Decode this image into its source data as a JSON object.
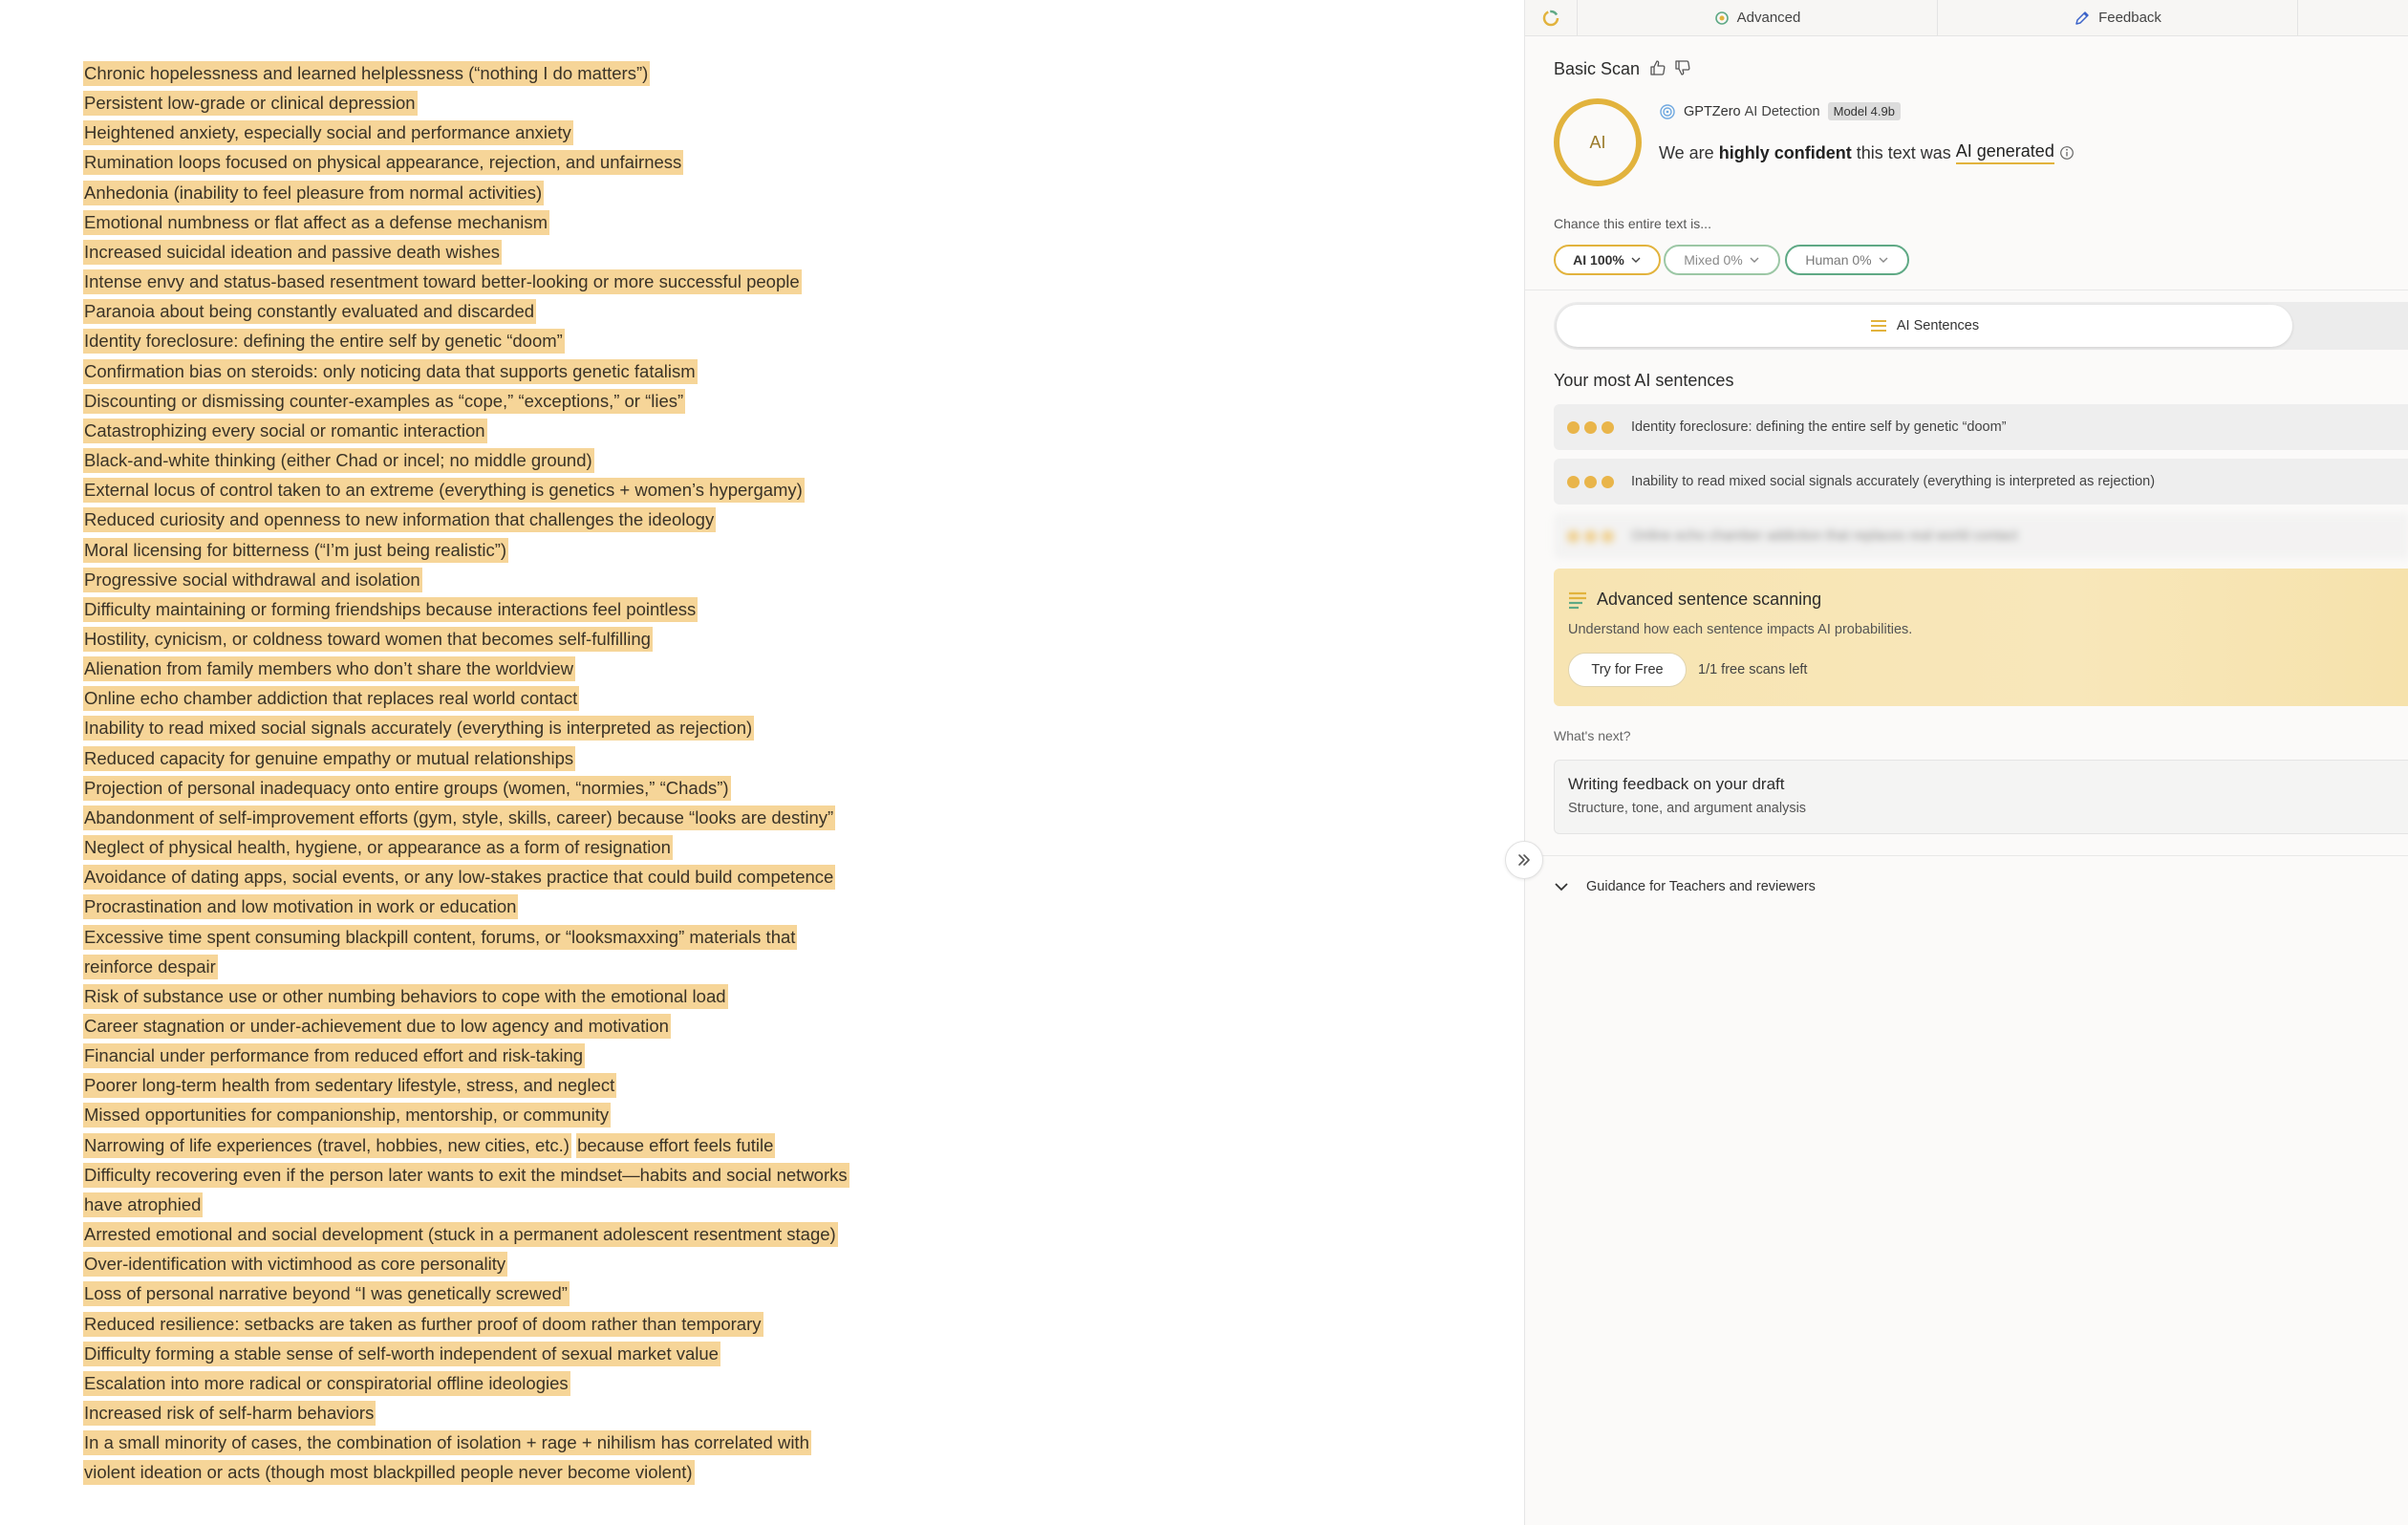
{
  "document": {
    "lines": [
      {
        "segments": [
          "Chronic hopelessness and learned helplessness (“nothing I do matters”)"
        ]
      },
      {
        "segments": [
          "Persistent low-grade or clinical depression"
        ]
      },
      {
        "segments": [
          "Heightened anxiety, especially social and performance anxiety"
        ]
      },
      {
        "segments": [
          "Rumination loops focused on physical appearance, rejection, and unfairness"
        ]
      },
      {
        "segments": [
          "Anhedonia (inability to feel pleasure from normal activities)"
        ]
      },
      {
        "segments": [
          "Emotional numbness or flat affect as a defense mechanism"
        ]
      },
      {
        "segments": [
          "Increased suicidal ideation and passive death wishes"
        ]
      },
      {
        "segments": [
          "Intense envy and status-based resentment toward better-looking or more successful people"
        ]
      },
      {
        "segments": [
          "Paranoia about being constantly evaluated and discarded"
        ]
      },
      {
        "segments": [
          "Identity foreclosure: defining the entire self by genetic “doom”"
        ]
      },
      {
        "segments": [
          "Confirmation bias on steroids: only noticing data that supports genetic fatalism"
        ]
      },
      {
        "segments": [
          "Discounting or dismissing counter-examples as “cope,” “exceptions,” or “lies”"
        ]
      },
      {
        "segments": [
          "Catastrophizing every social or romantic interaction"
        ]
      },
      {
        "segments": [
          "Black-and-white thinking (either Chad or incel; no middle ground)"
        ]
      },
      {
        "segments": [
          "External locus of control taken to an extreme (everything is genetics + women’s hypergamy)"
        ]
      },
      {
        "segments": [
          "Reduced curiosity and openness to new information that challenges the ideology"
        ]
      },
      {
        "segments": [
          "Moral licensing for bitterness (“I’m just being realistic”)"
        ]
      },
      {
        "segments": [
          "Progressive social withdrawal and isolation"
        ]
      },
      {
        "segments": [
          "Difficulty maintaining or forming friendships because interactions feel pointless"
        ]
      },
      {
        "segments": [
          "Hostility, cynicism, or coldness toward women that becomes self-fulfilling"
        ]
      },
      {
        "segments": [
          "Alienation from family members who don’t share the worldview"
        ]
      },
      {
        "segments": [
          "Online echo chamber addiction that replaces real world contact"
        ]
      },
      {
        "segments": [
          "Inability to read mixed social signals accurately (everything is interpreted as rejection)"
        ]
      },
      {
        "segments": [
          "Reduced capacity for genuine empathy or mutual relationships"
        ]
      },
      {
        "segments": [
          "Projection of personal inadequacy onto entire groups (women, “normies,” “Chads”)"
        ]
      },
      {
        "segments": [
          "Abandonment of self-improvement efforts (gym, style, skills, career) because “looks are destiny”"
        ]
      },
      {
        "segments": [
          "Neglect of physical health, hygiene, or appearance as a form of resignation"
        ]
      },
      {
        "segments": [
          "Avoidance of dating apps, social events, or any low-stakes practice that could build competence"
        ]
      },
      {
        "segments": [
          "Procrastination and low motivation in work or education"
        ]
      },
      {
        "segments": [
          "Excessive time spent consuming blackpill content, forums, or “looksmaxxing” materials that "
        ]
      },
      {
        "segments": [
          "reinforce despair"
        ]
      },
      {
        "segments": [
          "Risk of substance use or other numbing behaviors to cope with the emotional load"
        ]
      },
      {
        "segments": [
          "Career stagnation or under-achievement due to low agency and motivation"
        ]
      },
      {
        "segments": [
          "Financial under performance from reduced effort and risk-taking"
        ]
      },
      {
        "segments": [
          "Poorer long-term health from sedentary lifestyle, stress, and neglect"
        ]
      },
      {
        "segments": [
          "Missed opportunities for companionship, mentorship, or community"
        ]
      },
      {
        "segments": [
          "Narrowing of life experiences (travel, hobbies, new cities, etc.)",
          "because effort feels futile"
        ]
      },
      {
        "segments": [
          "Difficulty recovering even if the person later wants to exit the mindset—habits and social networks "
        ]
      },
      {
        "segments": [
          "have atrophied"
        ]
      },
      {
        "segments": [
          "Arrested emotional and social development (stuck in a permanent adolescent resentment stage)"
        ]
      },
      {
        "segments": [
          "Over-identification with victimhood as core personality"
        ]
      },
      {
        "segments": [
          "Loss of personal narrative beyond “I was genetically screwed”"
        ]
      },
      {
        "segments": [
          "Reduced resilience: setbacks are taken as further proof of doom rather than temporary"
        ]
      },
      {
        "segments": [
          "Difficulty forming a stable sense of self-worth independent of sexual market value"
        ]
      },
      {
        "segments": [
          "Escalation into more radical or conspiratorial offline ideologies"
        ]
      },
      {
        "segments": [
          "Increased risk of self-harm behaviors"
        ]
      },
      {
        "segments": [
          "In a small minority of cases, the combination of isolation + rage + nihilism has correlated with "
        ]
      },
      {
        "segments": [
          "violent ideation or acts (though most blackpilled people never become violent)"
        ]
      }
    ],
    "highlight_color": "#f6d598"
  },
  "panel": {
    "tabs": {
      "advanced": "Advanced",
      "feedback": "Feedback"
    },
    "basic_scan_title": "Basic Scan",
    "ai_circle_label": "AI",
    "detector_name": "GPTZero",
    "detector_suffix": "AI Detection",
    "model_badge": "Model 4.9b",
    "verdict": {
      "prefix": "We are",
      "confidence": "highly confident",
      "middle": "this text was",
      "label": "AI generated"
    },
    "chance_label": "Chance this entire text is...",
    "pills": {
      "ai": "AI 100%",
      "mixed": "Mixed 0%",
      "human": "Human 0%"
    },
    "segment_label": "AI Sentences",
    "most_ai_title": "Your most AI sentences",
    "sentences": [
      "Identity foreclosure: defining the entire self by genetic “doom”",
      "Inability to read mixed social signals accurately (everything is interpreted as rejection)",
      "Online echo chamber addiction that replaces real world contact"
    ],
    "upsell": {
      "title": "Advanced sentence scanning",
      "desc": "Understand how each sentence impacts AI probabilities.",
      "button": "Try for Free",
      "scans_left": "1/1 free scans left"
    },
    "whats_next": "What's next?",
    "feedback_card": {
      "title": "Writing feedback on your draft",
      "sub": "Structure, tone, and argument analysis"
    },
    "guidance": "Guidance for Teachers and reviewers",
    "colors": {
      "accent_ai": "#e2b33d",
      "mixed": "#9cc7a5",
      "human": "#5fa985",
      "upsell_bg": "#f7e4b2"
    }
  }
}
